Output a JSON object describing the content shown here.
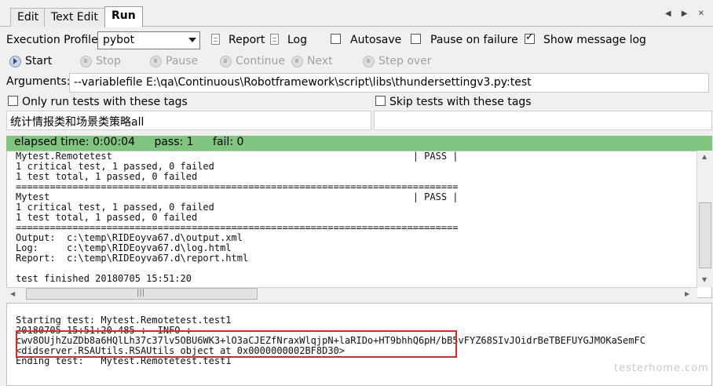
{
  "tabs": [
    {
      "label": "Edit"
    },
    {
      "label": "Text Edit"
    },
    {
      "label": "Run"
    }
  ],
  "tab_nav": "◀ ▶ ✕",
  "profile": {
    "label": "Execution Profile:",
    "value": "pybot",
    "report_label": "Report",
    "log_label": "Log",
    "autosave_label": "Autosave",
    "autosave_checked": false,
    "pause_label": "Pause on failure",
    "pause_checked": false,
    "show_log_label": "Show message log",
    "show_log_checked": true
  },
  "toolbar": {
    "start": "Start",
    "stop": "Stop",
    "pause": "Pause",
    "continue": "Continue",
    "next": "Next",
    "step_over": "Step over"
  },
  "arguments": {
    "label": "Arguments:",
    "value": "--variablefile E:\\qa\\Continuous\\Robotframework\\script\\libs\\thundersettingv3.py:test"
  },
  "tags": {
    "only_run_label": "Only run tests with these tags",
    "only_run_value": "统计情报类和场景类策略all",
    "skip_label": "Skip tests with these tags",
    "skip_value": ""
  },
  "status": {
    "elapsed": "elapsed time: 0:00:04",
    "pass": "pass: 1",
    "fail": "fail: 0",
    "color": "#7fc47f"
  },
  "output_lines": [
    "Mytest.Remotetest                                                     | PASS |",
    "1 critical test, 1 passed, 0 failed",
    "1 test total, 1 passed, 0 failed",
    "==============================================================================",
    "Mytest                                                                | PASS |",
    "1 critical test, 1 passed, 0 failed",
    "1 test total, 1 passed, 0 failed",
    "==============================================================================",
    "Output:  c:\\temp\\RIDEoyva67.d\\output.xml",
    "Log:     c:\\temp\\RIDEoyva67.d\\log.html",
    "Report:  c:\\temp\\RIDEoyva67.d\\report.html",
    "",
    "test finished 20180705 15:51:20"
  ],
  "message_lines": [
    "Starting test: Mytest.Remotetest.test1",
    "20180705 15:51:20.485 :  INFO :",
    "cwv8OUjhZuZDb8a6HQlLh37c37lv5OBU6WK3+lO3aCJEZfNraxWlqjpN+laRIDo+HT9bhhQ6pH/bB5vFYZ68SIvJOidrBeTBEFUYGJMOKaSemFC",
    "<didserver.RSAUtils.RSAUtils object at 0x0000000002BF8D30>",
    "Ending test:   Mytest.Remotetest.test1"
  ],
  "watermark": "testerhome.com",
  "highlight_color": "#d32a2a"
}
